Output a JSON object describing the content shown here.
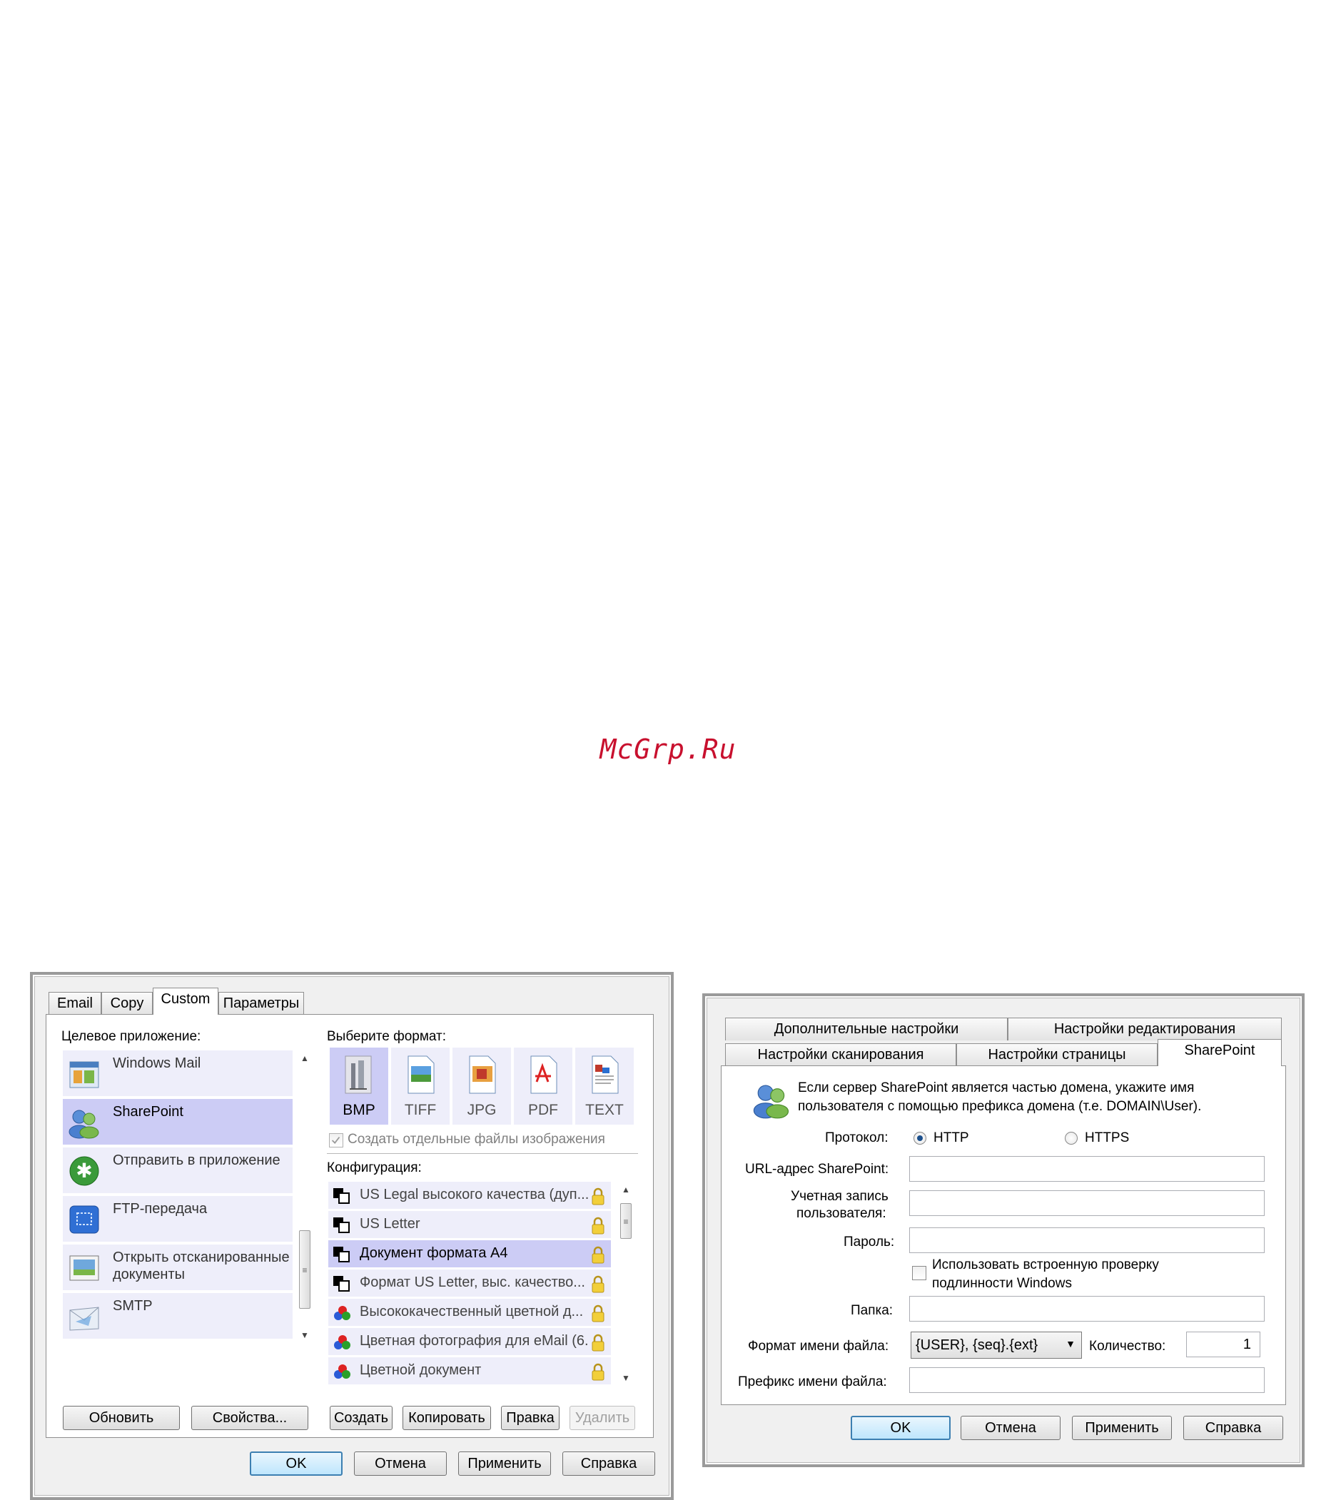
{
  "watermark": "McGrp.Ru",
  "left_dialog": {
    "tabs": [
      "Email",
      "Copy",
      "Custom",
      "Параметры"
    ],
    "target_label": "Целевое приложение:",
    "apps": [
      {
        "name": "Windows Mail",
        "icon": "windows-mail-icon"
      },
      {
        "name": "SharePoint",
        "icon": "sharepoint-icon",
        "selected": true
      },
      {
        "name": "Отправить в приложение",
        "icon": "send-to-app-icon"
      },
      {
        "name": "FTP-передача",
        "icon": "ftp-icon"
      },
      {
        "name": "Открыть отсканированные документы",
        "icon": "open-scanned-icon"
      },
      {
        "name": "SMTP",
        "icon": "smtp-envelope-icon"
      }
    ],
    "format_label": "Выберите формат:",
    "formats": [
      {
        "name": "BMP",
        "selected": true
      },
      {
        "name": "TIFF"
      },
      {
        "name": "JPG"
      },
      {
        "name": "PDF"
      },
      {
        "name": "TEXT"
      }
    ],
    "separate_files_label": "Создать отдельные файлы изображения",
    "separate_files_checked": true,
    "config_label": "Конфигурация:",
    "configs": [
      {
        "name": "US Legal высокого качества (дуп...",
        "kind": "bw"
      },
      {
        "name": "US Letter",
        "kind": "bw"
      },
      {
        "name": "Документ формата А4",
        "kind": "bw",
        "selected": true
      },
      {
        "name": "Формат US Letter, выс. качество...",
        "kind": "bw"
      },
      {
        "name": "Высококачественный цветной д...",
        "kind": "color"
      },
      {
        "name": "Цветная фотография для eMail (6...",
        "kind": "color"
      },
      {
        "name": "Цветной документ",
        "kind": "color"
      }
    ],
    "buttons": {
      "refresh": "Обновить",
      "properties": "Свойства...",
      "create": "Создать",
      "copy": "Копировать",
      "edit": "Правка",
      "delete": "Удалить",
      "ok": "OK",
      "cancel": "Отмена",
      "apply": "Применить",
      "help": "Справка"
    }
  },
  "right_dialog": {
    "tabs_back": [
      "Дополнительные настройки",
      "Настройки редактирования"
    ],
    "tabs_front": [
      "Настройки сканирования",
      "Настройки страницы",
      "SharePoint"
    ],
    "info_line1": "Если сервер SharePoint является частью домена, укажите имя",
    "info_line2": "пользователя с помощью префикса домена (т.е. DOMAIN\\User).",
    "protocol_label": "Протокол:",
    "protocol_options": [
      "HTTP",
      "HTTPS"
    ],
    "protocol_selected": "HTTP",
    "url_label": "URL-адрес SharePoint:",
    "url_value": "",
    "account_label_1": "Учетная запись",
    "account_label_2": "пользователя:",
    "account_value": "",
    "password_label": "Пароль:",
    "password_value": "",
    "windows_auth_line1": "Использовать встроенную проверку",
    "windows_auth_line2": "подлинности Windows",
    "windows_auth_checked": false,
    "folder_label": "Папка:",
    "folder_value": "",
    "filename_format_label": "Формат имени файла:",
    "filename_format_value": "{USER}, {seq}.{ext}",
    "count_label": "Количество:",
    "count_value": "1",
    "prefix_label": "Префикс имени файла:",
    "prefix_value": "",
    "buttons": {
      "ok": "OK",
      "cancel": "Отмена",
      "apply": "Применить",
      "help": "Справка"
    }
  }
}
